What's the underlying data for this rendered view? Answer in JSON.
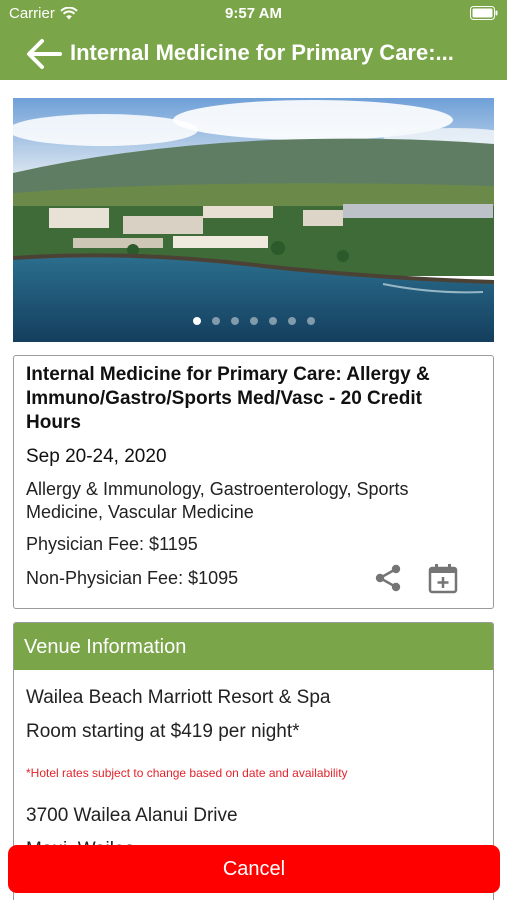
{
  "status_bar": {
    "carrier": "Carrier",
    "time": "9:57 AM",
    "icons": [
      "wifi-icon",
      "battery-icon"
    ]
  },
  "nav": {
    "back_icon": "arrow-left-icon",
    "title": "Internal Medicine for Primary Care:..."
  },
  "hero": {
    "image": "aerial view of coastal resort",
    "page_count": 7,
    "active_page": 1
  },
  "event": {
    "title": "Internal Medicine for Primary Care: Allergy & Immuno/Gastro/Sports Med/Vasc - 20 Credit Hours",
    "date": "Sep 20-24, 2020",
    "specialties": "Allergy & Immunology, Gastroenterology, Sports Medicine, Vascular Medicine",
    "physician_fee": "Physician Fee: $1195",
    "non_physician_fee": "Non-Physician Fee: $1095",
    "actions": [
      "share-icon",
      "calendar-add-icon"
    ]
  },
  "venue": {
    "header": "Venue Information",
    "name": "Wailea Beach Marriott Resort & Spa",
    "room_rate": "Room starting at $419 per night*",
    "note": "*Hotel rates subject to change based on date and availability",
    "address": "3700 Wailea Alanui Drive",
    "city": "Maui, Wailea"
  },
  "cancel_button": {
    "label": "Cancel"
  },
  "colors": {
    "brand_green": "#7aa549",
    "cancel_red": "#ff0000",
    "note_red": "#e3242b"
  }
}
